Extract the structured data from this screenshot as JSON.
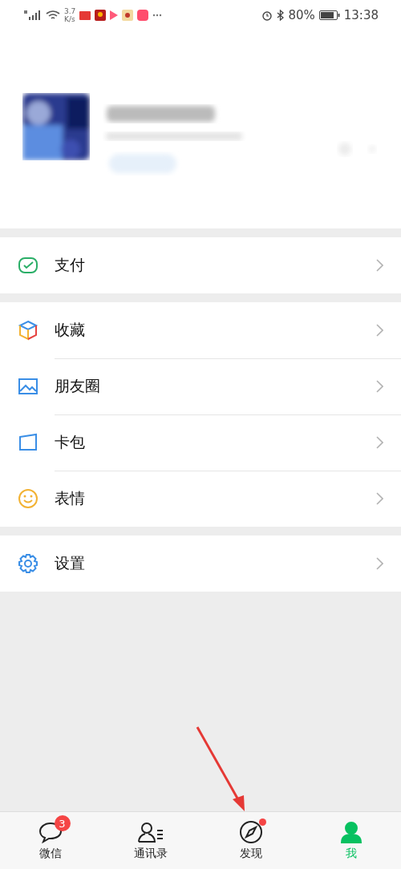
{
  "status_bar": {
    "network_speed": [
      "3.7",
      "K/s"
    ],
    "battery": "80%",
    "time": "13:38"
  },
  "menu_groups": [
    {
      "items": [
        {
          "kind": "pay",
          "label": "支付"
        }
      ]
    },
    {
      "items": [
        {
          "kind": "favorites",
          "label": "收藏"
        },
        {
          "kind": "moments",
          "label": "朋友圈"
        },
        {
          "kind": "cards",
          "label": "卡包"
        },
        {
          "kind": "stickers",
          "label": "表情"
        }
      ]
    },
    {
      "items": [
        {
          "kind": "settings",
          "label": "设置"
        }
      ]
    }
  ],
  "tab_bar": [
    {
      "kind": "chats",
      "label": "微信",
      "selected": false,
      "badge": "3",
      "dot": false
    },
    {
      "kind": "contacts",
      "label": "通讯录",
      "selected": false,
      "dot": false
    },
    {
      "kind": "discover",
      "label": "发现",
      "selected": false,
      "dot": true
    },
    {
      "kind": "me",
      "label": "我",
      "selected": true,
      "dot": false
    }
  ]
}
